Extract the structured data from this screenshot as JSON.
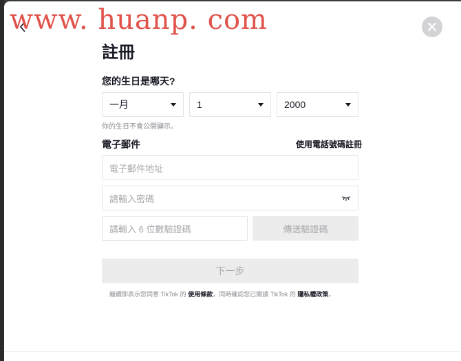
{
  "watermark": "www. huanp. com",
  "signup": {
    "title": "註冊",
    "birthday_label": "您的生日是哪天?",
    "month": "一月",
    "day": "1",
    "year": "2000",
    "birthday_hint": "你的生日不會公開顯示。",
    "email_label": "電子郵件",
    "use_phone_link": "使用電話號碼註冊",
    "email_placeholder": "電子郵件地址",
    "password_placeholder": "請輸入密碼",
    "code_placeholder": "請輸入 6 位數驗證碼",
    "send_code_button": "傳送驗證碼",
    "next_button": "下一步",
    "terms_prefix": "繼續即表示您同意 TikTok 的",
    "terms_link": "使用條款",
    "terms_middle": "，同時確認您已閱讀 TikTok 的",
    "privacy_link": "隱私權政策",
    "terms_suffix": "。"
  },
  "icons": {
    "back": "chevron-left-icon",
    "close": "close-icon",
    "password_toggle": "eye-closed-icon",
    "dropdown": "caret-down-icon"
  },
  "colors": {
    "watermark": "#e0544c",
    "disabled_button": "#ececec",
    "close_button": "#d3d3d5"
  }
}
